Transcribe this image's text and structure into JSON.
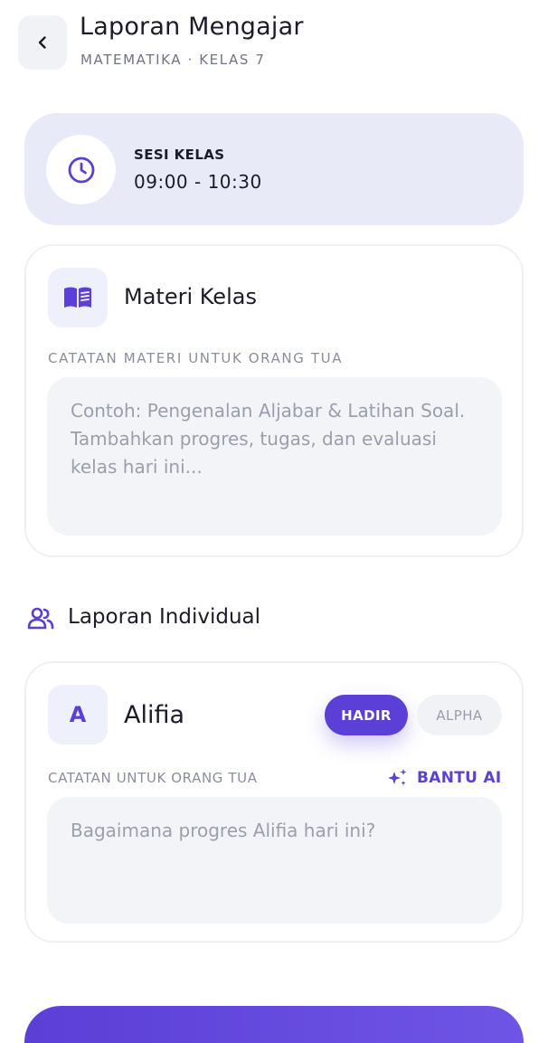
{
  "header": {
    "title": "Laporan Mengajar",
    "subtitle": "MATEMATIKA · KELAS 7",
    "back_icon": "chevron-left-icon"
  },
  "session": {
    "label": "SESI KELAS",
    "time": "09:00 - 10:30",
    "icon": "clock-icon"
  },
  "materi": {
    "title": "Materi Kelas",
    "icon": "book-icon",
    "field_label": "CATATAN MATERI UNTUK ORANG TUA",
    "placeholder": "Contoh: Pengenalan Aljabar & Latihan Soal. Tambahkan progres, tugas, dan evaluasi kelas hari ini..."
  },
  "individual": {
    "title": "Laporan Individual",
    "icon": "users-icon",
    "students": [
      {
        "initial": "A",
        "name": "Alifia",
        "status_options": [
          "HADIR",
          "ALPHA"
        ],
        "selected_status": "HADIR",
        "field_label": "CATATAN UNTUK ORANG TUA",
        "ai_label": "BANTU AI",
        "placeholder": "Bagaimana progres Alifia hari ini?"
      }
    ]
  },
  "colors": {
    "accent": "#5b3fd6",
    "session_bg": "#e9eaf8",
    "input_bg": "#f3f4f8"
  }
}
